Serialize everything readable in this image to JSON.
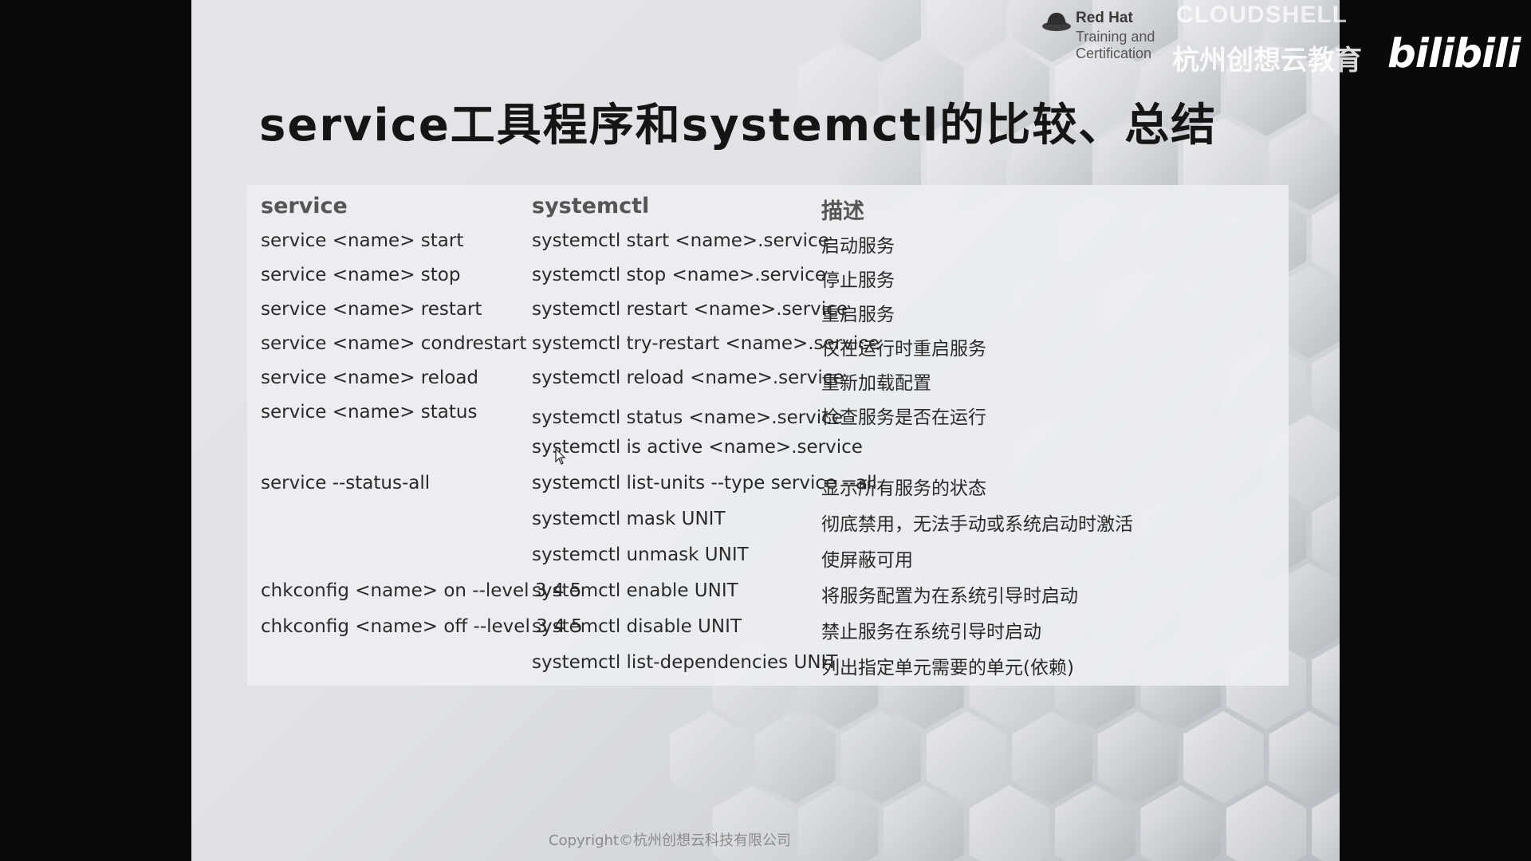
{
  "slide": {
    "title": "service工具程序和systemctl的比较、总结",
    "logo": {
      "brand": "Red Hat",
      "subtitle_line1": "Training and",
      "subtitle_line2": "Certification"
    },
    "copyright": "Copyright©杭州创想云科技有限公司"
  },
  "watermark": {
    "cloud_text": "CLOUDSHELL",
    "cn_text": "杭州创想云教育",
    "platform": "bilibili"
  },
  "table": {
    "headers": [
      "service",
      "systemctl",
      "描述"
    ],
    "rows": [
      {
        "service": "service <name> start",
        "systemctl": "systemctl start <name>.service",
        "desc": "启动服务"
      },
      {
        "service": "service <name> stop",
        "systemctl": "systemctl stop <name>.service",
        "desc": "停止服务"
      },
      {
        "service": "service <name> restart",
        "systemctl": "systemctl restart <name>.service",
        "desc": "重启服务"
      },
      {
        "service": "service <name> condrestart",
        "systemctl": "systemctl try-restart <name>.service",
        "desc": "仅在运行时重启服务"
      },
      {
        "service": "service <name> reload",
        "systemctl": "systemctl reload <name>.service",
        "desc": "重新加载配置"
      },
      {
        "service": "service <name> status",
        "systemctl": "systemctl status <name>.service",
        "systemctl_2": "systemctl is active <name>.service",
        "desc": "检查服务是否在运行"
      },
      {
        "service": "service --status-all",
        "systemctl": "systemctl list-units --type service --all",
        "desc": "显示所有服务的状态"
      },
      {
        "service": "",
        "systemctl": "systemctl mask  UNIT",
        "desc": "彻底禁用，无法手动或系统启动时激活"
      },
      {
        "service": "",
        "systemctl": "systemctl unmask UNIT",
        "desc": "使屏蔽可用"
      },
      {
        "service": "chkconfig <name> on --level 3 4 5",
        "systemctl": "systemctl enable UNIT",
        "desc": "将服务配置为在系统引导时启动"
      },
      {
        "service": "chkconfig <name> off --level 3 4 5",
        "systemctl": "systemctl disable UNIT",
        "desc": "禁止服务在系统引导时启动"
      },
      {
        "service": "",
        "systemctl": "systemctl list-dependencies UNIT",
        "desc": "列出指定单元需要的单元(依赖)"
      }
    ]
  }
}
